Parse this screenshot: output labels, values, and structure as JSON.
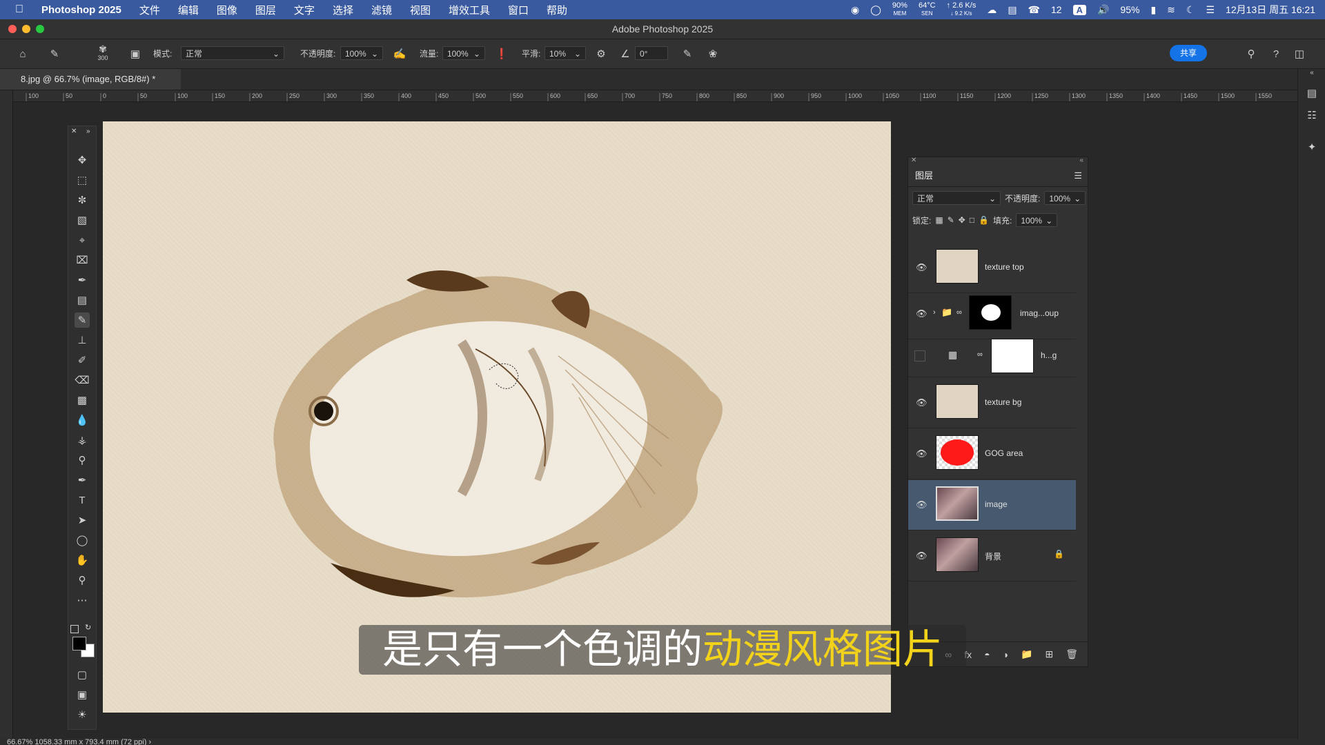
{
  "menubar": {
    "app_name": "Photoshop 2025",
    "items": [
      "文件",
      "编辑",
      "图像",
      "图层",
      "文字",
      "选择",
      "滤镜",
      "视图",
      "增效工具",
      "窗口",
      "帮助"
    ],
    "mem": "90%",
    "mem_label": "MEM",
    "sen": "64°C",
    "sen_label": "SEN",
    "net_up": "↑ 2.6 K/s",
    "net_down": "↓ 9.2 K/s",
    "wechat_count": "12",
    "input_badge": "A",
    "battery": "95%",
    "datetime": "12月13日 周五 16:21"
  },
  "window": {
    "title": "Adobe Photoshop 2025"
  },
  "options": {
    "brush_size": "300",
    "mode_label": "模式:",
    "mode_value": "正常",
    "opacity_label": "不透明度:",
    "opacity_value": "100%",
    "flow_label": "流量:",
    "flow_value": "100%",
    "smoothing_label": "平滑:",
    "smoothing_value": "10%",
    "angle_value": "0°",
    "share_label": "共享"
  },
  "document": {
    "tab_label": "8.jpg @ 66.7% (image, RGB/8#) *"
  },
  "ruler_top_labels": [
    "100",
    "50",
    "0",
    "50",
    "100",
    "150",
    "200",
    "250",
    "300",
    "350",
    "400",
    "450",
    "500",
    "550",
    "600",
    "650",
    "700",
    "750",
    "800",
    "850",
    "900",
    "950",
    "1000",
    "1050",
    "1100",
    "1150",
    "1200",
    "1250",
    "1300",
    "1350",
    "1400",
    "1450",
    "1500",
    "1550"
  ],
  "layers_panel": {
    "tab": "图层",
    "blend_mode": "正常",
    "opacity_label": "不透明度:",
    "opacity_value": "100%",
    "lock_label": "锁定:",
    "fill_label": "填充:",
    "fill_value": "100%",
    "layers": [
      {
        "name": "texture top",
        "visible": true,
        "selected": false
      },
      {
        "name": "imag...oup",
        "visible": true,
        "selected": false
      },
      {
        "name": "h...g",
        "visible": false,
        "selected": false
      },
      {
        "name": "texture bg",
        "visible": true,
        "selected": false
      },
      {
        "name": "GOG area",
        "visible": true,
        "selected": false
      },
      {
        "name": "image",
        "visible": true,
        "selected": true
      },
      {
        "name": "背景",
        "visible": true,
        "selected": false
      }
    ]
  },
  "statusbar": {
    "text": "66.67%    1058.33 mm x 793.4 mm (72 ppi)  ›"
  },
  "subtitle": {
    "part1": "是只有一个色调的",
    "part2": "动漫风格图片"
  },
  "colors": {
    "accent": "#1473e6",
    "selected_layer": "#46596f",
    "gog_area": "#ff1a1a",
    "canvas": "#e8ddc9"
  }
}
